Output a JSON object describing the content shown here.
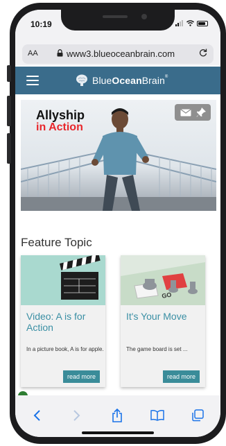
{
  "status_bar": {
    "time": "10:19"
  },
  "browser": {
    "text_size_label": "AA",
    "url": "www3.blueoceanbrain.com"
  },
  "site": {
    "brand_prefix": "Blue",
    "brand_bold": "Ocean",
    "brand_suffix": "Brain",
    "brand_mark": "®",
    "brand_color": "#3a6c8b"
  },
  "hero": {
    "title_line1": "Allyship",
    "title_line2": "in Action",
    "accent_color": "#e8262b"
  },
  "feature": {
    "section_title": "Feature Topic",
    "cards": [
      {
        "title": "Video: A is for Action",
        "excerpt": "In a picture book, A is for apple.",
        "button": "read more",
        "image_icon": "clapperboard-icon"
      },
      {
        "title": "It's Your Move",
        "excerpt": "The game board is set ...",
        "button": "read more",
        "image_icon": "board-game-icon"
      }
    ]
  },
  "toolbar": {
    "icons": [
      "back-icon",
      "forward-icon",
      "share-icon",
      "bookmarks-icon",
      "tabs-icon"
    ],
    "accent_color": "#1a73e8"
  }
}
